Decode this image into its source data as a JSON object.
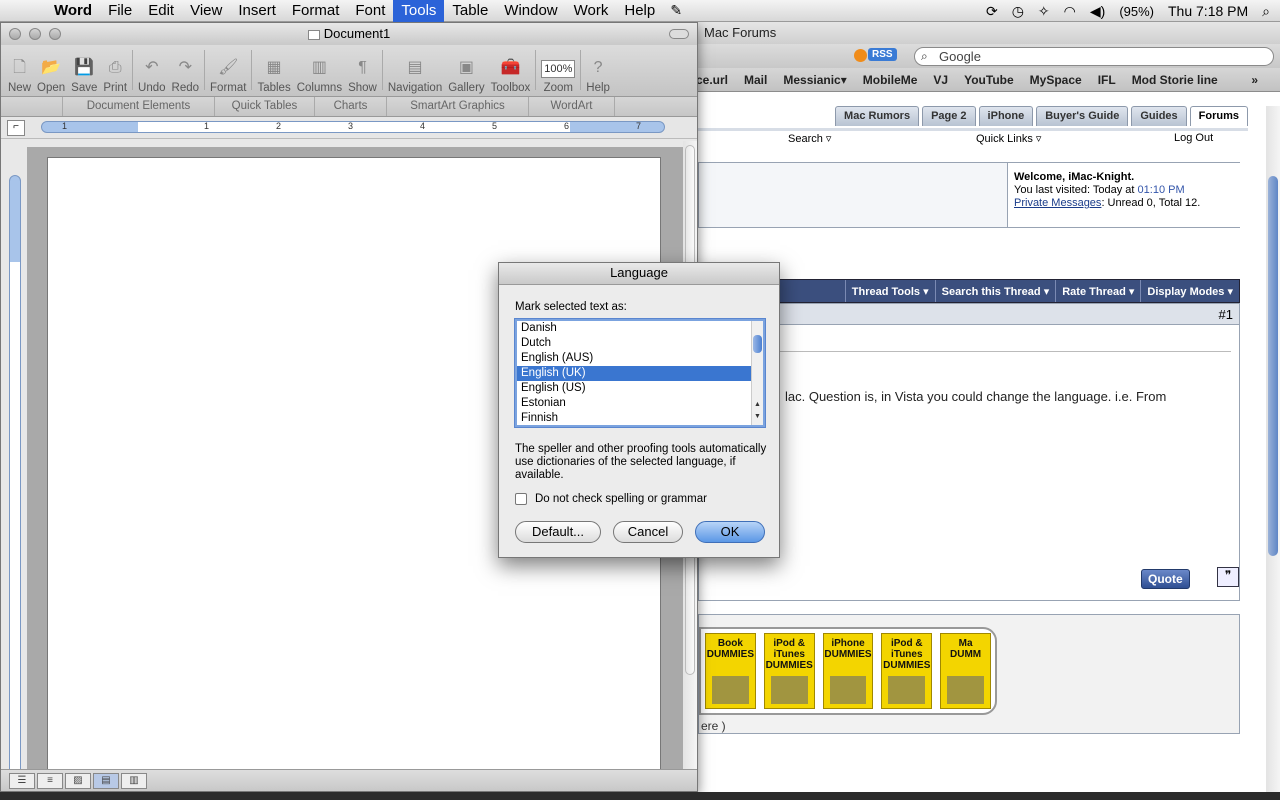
{
  "menubar": {
    "app": "Word",
    "items": [
      "File",
      "Edit",
      "View",
      "Insert",
      "Format",
      "Font",
      "Tools",
      "Table",
      "Window",
      "Work",
      "Help"
    ],
    "active": "Tools",
    "battery": "(95%)",
    "clock": "Thu 7:18 PM"
  },
  "browser": {
    "title": "Mac Forums",
    "rss": "RSS",
    "search_placeholder": "Google",
    "bookmarks": [
      "ce.url",
      "Mail",
      "Messianic▾",
      "MobileMe",
      "VJ",
      "YouTube",
      "MySpace",
      "IFL",
      "Mod Storie line"
    ],
    "forum_tabs": [
      "Mac Rumors",
      "Page 2",
      "iPhone",
      "Buyer's Guide",
      "Guides",
      "Forums"
    ],
    "selected_tab": "Forums",
    "subnav": {
      "search": "Search ▿",
      "quick_links": "Quick Links ▿",
      "logout": "Log Out"
    },
    "welcome": {
      "title": "Welcome, iMac-Knight.",
      "last_visited_label": "You last visited: Today at ",
      "last_visited_time": "01:10 PM",
      "pm_link": "Private Messages",
      "pm_counts": ": Unread 0, Total 12."
    },
    "thread_tools": [
      "Thread Tools ▾",
      "Search this Thread ▾",
      "Rate Thread ▾",
      "Display Modes ▾"
    ],
    "post_number": "#1",
    "post_text": "lac. Question is, in Vista you could change the language. i.e. From",
    "quote_label": "Quote",
    "books": [
      "Book\nDUMMIES",
      "iPod & iTunes\nDUMMIES",
      "iPhone\nDUMMIES",
      "iPod & iTunes\nDUMMIES",
      "Ma\nDUMM"
    ],
    "ad_text": "ere )"
  },
  "word": {
    "doc_title": "Document1",
    "toolbar": [
      {
        "label": "New",
        "icon": "new-doc-icon",
        "glyph": "🗋"
      },
      {
        "label": "Open",
        "icon": "open-folder-icon",
        "glyph": "📂"
      },
      {
        "label": "Save",
        "icon": "save-disk-icon",
        "glyph": "💾"
      },
      {
        "label": "Print",
        "icon": "printer-icon",
        "glyph": "⎙"
      },
      {
        "label": "Undo",
        "icon": "undo-icon",
        "glyph": "↶"
      },
      {
        "label": "Redo",
        "icon": "redo-icon",
        "glyph": "↷"
      },
      {
        "label": "Format",
        "icon": "format-brush-icon",
        "glyph": "🖌"
      },
      {
        "label": "Tables",
        "icon": "table-grid-icon",
        "glyph": "▦"
      },
      {
        "label": "Columns",
        "icon": "columns-icon",
        "glyph": "▥"
      },
      {
        "label": "Show",
        "icon": "pilcrow-icon",
        "glyph": "¶"
      },
      {
        "label": "Navigation",
        "icon": "navigation-pane-icon",
        "glyph": "▤"
      },
      {
        "label": "Gallery",
        "icon": "gallery-icon",
        "glyph": "▣"
      },
      {
        "label": "Toolbox",
        "icon": "toolbox-icon",
        "glyph": "🧰"
      },
      {
        "label": "Zoom",
        "icon": "zoom-box",
        "glyph": ""
      },
      {
        "label": "Help",
        "icon": "help-icon",
        "glyph": "?"
      }
    ],
    "zoom_value": "100%",
    "ribbon": [
      "Document Elements",
      "Quick Tables",
      "Charts",
      "SmartArt Graphics",
      "WordArt"
    ],
    "ruler_numbers": [
      "1",
      "1",
      "2",
      "3",
      "4",
      "5",
      "6",
      "7"
    ]
  },
  "dialog": {
    "title": "Language",
    "label": "Mark selected text as:",
    "languages": [
      "Danish",
      "Dutch",
      "English (AUS)",
      "English (UK)",
      "English (US)",
      "Estonian",
      "Finnish"
    ],
    "selected": "English (UK)",
    "description": "The speller and other proofing tools automatically use dictionaries of the selected language, if available.",
    "checkbox_label": "Do not check spelling or grammar",
    "checkbox_checked": false,
    "buttons": {
      "default": "Default...",
      "cancel": "Cancel",
      "ok": "OK"
    }
  }
}
